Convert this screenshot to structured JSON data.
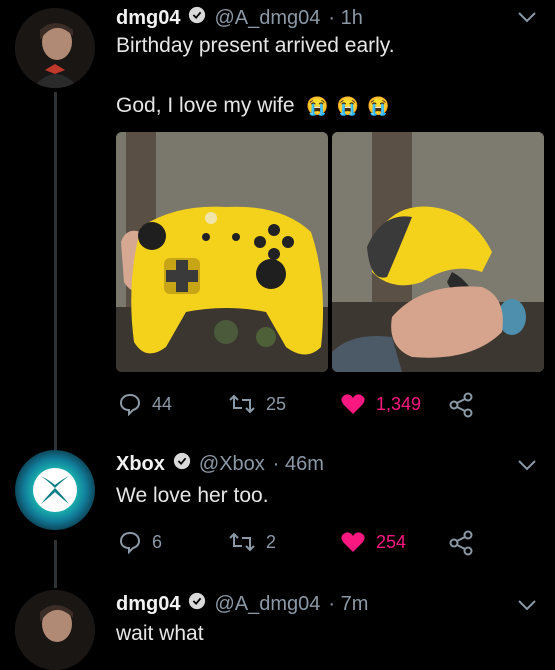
{
  "tweet1": {
    "name": "dmg04",
    "handle": "@A_dmg04",
    "time": "· 1h",
    "line1": "Birthday present arrived early.",
    "line2": "God, I love my wife",
    "emojis": [
      "😭",
      "😭",
      "😭"
    ],
    "replies": "44",
    "retweets": "25",
    "likes": "1,349"
  },
  "tweet2": {
    "name": "Xbox",
    "handle": "@Xbox",
    "time": "· 46m",
    "text": "We love her too.",
    "replies": "6",
    "retweets": "2",
    "likes": "254"
  },
  "tweet3": {
    "name": "dmg04",
    "handle": "@A_dmg04",
    "time": "· 7m",
    "text": "wait what"
  },
  "colors": {
    "like": "#f91880",
    "muted": "#8b98a5",
    "controller": "#f4d21b"
  },
  "icons": [
    "verified-icon",
    "chevron-down-icon",
    "reply-icon",
    "retweet-icon",
    "heart-icon",
    "share-icon",
    "xbox-logo-icon"
  ]
}
